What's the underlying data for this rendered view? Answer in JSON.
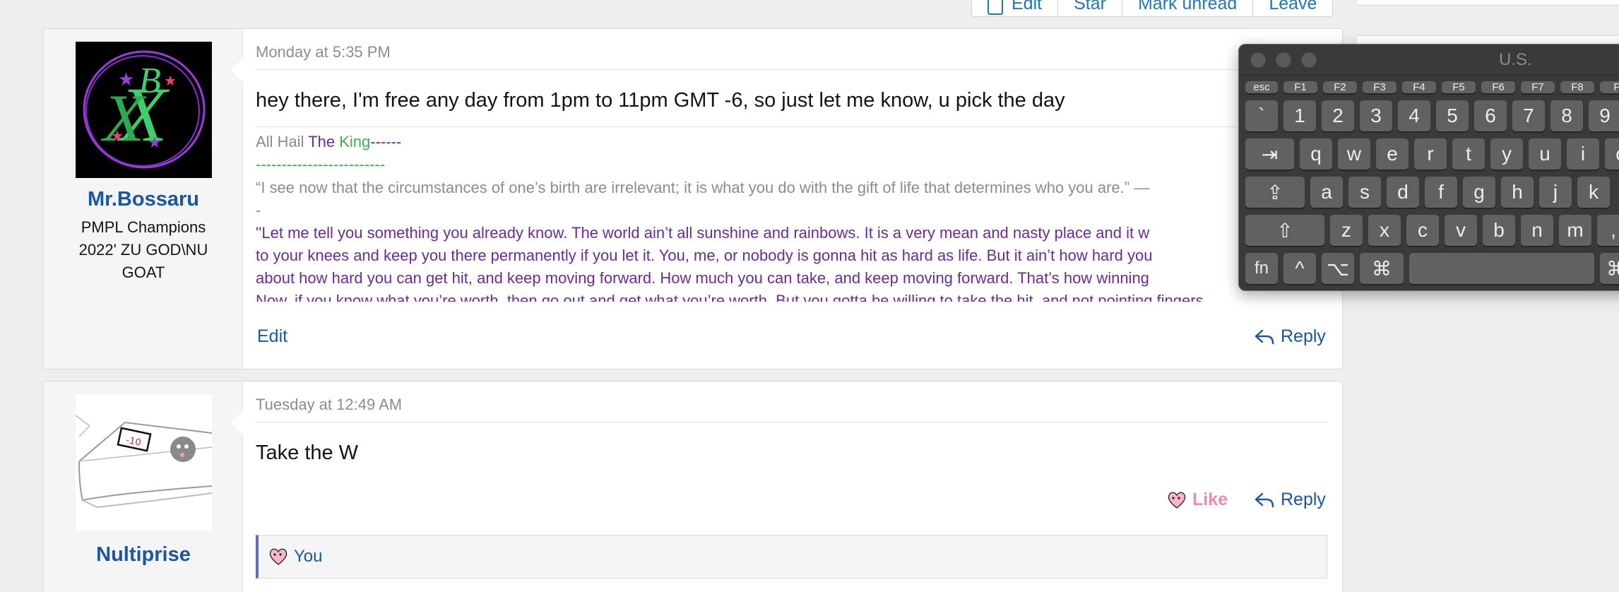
{
  "toolbar": {
    "edit": "Edit",
    "star": "Star",
    "mark_unread": "Mark unread",
    "leave": "Leave"
  },
  "posts": [
    {
      "username": "Mr.Bossaru",
      "user_title": "PMPL Champions 2022' ZU GOD\\NU GOAT",
      "date": "Monday at 5:35 PM",
      "message": "hey there, I'm free any day from 1pm to 11pm GMT -6, so just let me know, u pick the day",
      "signature": {
        "hail_prefix": "All Hail ",
        "the": "The",
        "king": "King",
        "dashes_after": "------",
        "dash_line": "-------------------------",
        "quote": "“I see now that the circumstances of one’s birth are irrelevant; it is what you do with the gift of life that determines who you are.” —",
        "dash_single": "-",
        "story_1": "''Let me tell you something you already know. The world ain’t all sunshine and rainbows. It is a very mean and nasty place and it w",
        "story_2": "to your knees and keep you there permanently if you let it. You, me, or nobody is gonna hit as hard as life. But it ain’t how hard you",
        "story_3": "about how hard you can get hit, and keep moving forward. How much you can take, and keep moving forward. That’s how winning",
        "story_4": "Now, if you know what you’re worth, then go out and get what you’re worth. But you gotta be willing to take the hit, and not pointing fingers"
      },
      "actions": {
        "edit": "Edit",
        "reply": "Reply"
      }
    },
    {
      "username": "Nultiprise",
      "date": "Tuesday at 12:49 AM",
      "message": "Take the W",
      "actions": {
        "like": "Like",
        "reply": "Reply"
      },
      "reactions": "You"
    }
  ],
  "keyboard_viewer": {
    "title": "U.S.",
    "function_row": [
      "esc",
      "F1",
      "F2",
      "F3",
      "F4",
      "F5",
      "F6",
      "F7",
      "F8",
      "F"
    ],
    "number_row": [
      "`",
      "1",
      "2",
      "3",
      "4",
      "5",
      "6",
      "7",
      "8",
      "9"
    ],
    "q_row": [
      "⇥",
      "q",
      "w",
      "e",
      "r",
      "t",
      "y",
      "u",
      "i",
      "o"
    ],
    "a_row": [
      "⇪",
      "a",
      "s",
      "d",
      "f",
      "g",
      "h",
      "j",
      "k"
    ],
    "z_row": [
      "⇧",
      "z",
      "x",
      "c",
      "v",
      "b",
      "n",
      "m",
      ","
    ],
    "bottom_row": [
      "fn",
      "^",
      "⌥",
      "⌘",
      "",
      "⌘"
    ]
  },
  "colors": {
    "link_blue": "#1a56a8",
    "signature_purple": "#6b2a99",
    "signature_green": "#3fb24a",
    "like_pink": "#f08bb0"
  }
}
